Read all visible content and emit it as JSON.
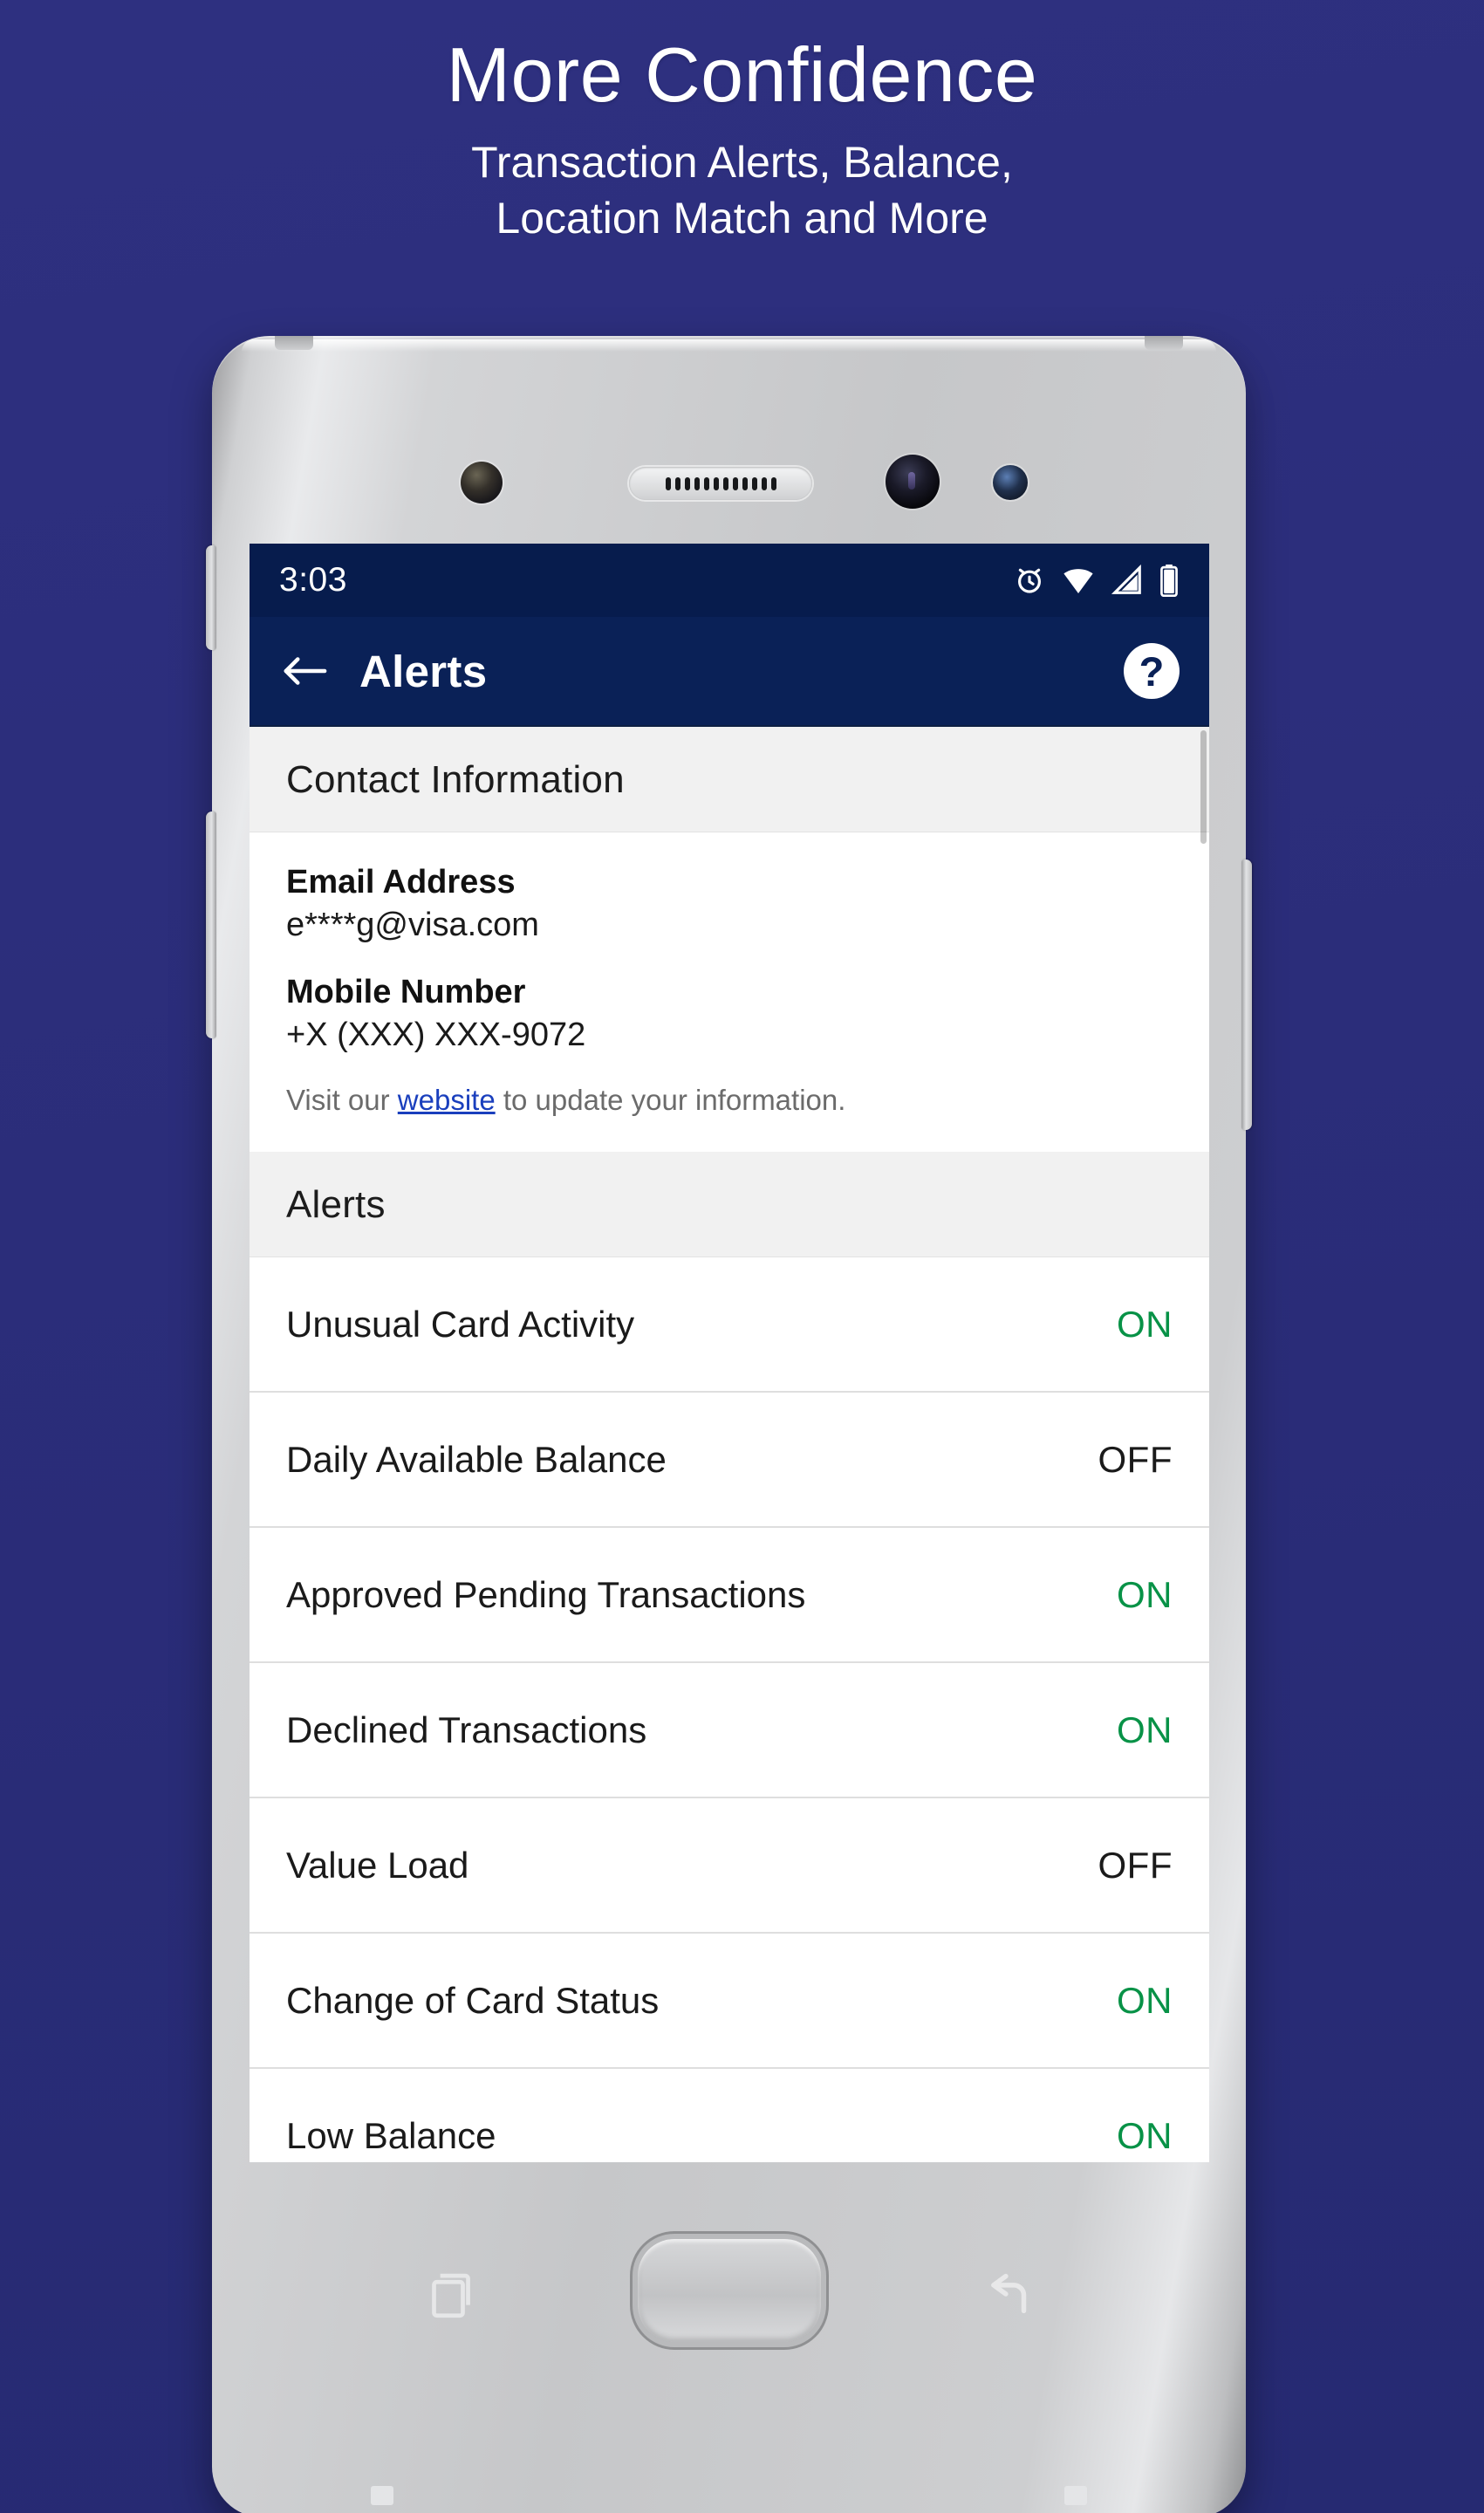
{
  "promo": {
    "title": "More Confidence",
    "subtitle_line1": "Transaction Alerts, Balance,",
    "subtitle_line2": "Location Match and More"
  },
  "status_bar": {
    "time": "3:03",
    "icons": [
      "alarm-icon",
      "wifi-icon",
      "signal-icon",
      "battery-icon"
    ]
  },
  "app_bar": {
    "back_label": "back-arrow-icon",
    "title": "Alerts",
    "help_label": "?"
  },
  "sections": {
    "contact": {
      "header": "Contact Information",
      "email_label": "Email Address",
      "email_value": "e****g@visa.com",
      "mobile_label": "Mobile Number",
      "mobile_value": "+X (XXX) XXX-9072",
      "visit_prefix": "Visit our ",
      "visit_link": "website",
      "visit_suffix": " to update your information."
    },
    "alerts": {
      "header": "Alerts",
      "items": [
        {
          "label": "Unusual Card Activity",
          "state": "ON"
        },
        {
          "label": "Daily Available Balance",
          "state": "OFF"
        },
        {
          "label": "Approved Pending Transactions",
          "state": "ON"
        },
        {
          "label": "Declined Transactions",
          "state": "ON"
        },
        {
          "label": "Value Load",
          "state": "OFF"
        },
        {
          "label": "Change of Card Status",
          "state": "ON"
        },
        {
          "label": "Low Balance",
          "state": "ON"
        }
      ]
    }
  },
  "nav_bar": {
    "recents": "recents-icon",
    "home": "home-button",
    "back": "back-icon"
  },
  "colors": {
    "background": "#2b2d7a",
    "app_bar": "#0a2157",
    "status_bar": "#071c4d",
    "state_on": "#089247",
    "state_off": "#1a1a1a",
    "link": "#1a3fbd",
    "section_header_bg": "#f1f1f1"
  }
}
